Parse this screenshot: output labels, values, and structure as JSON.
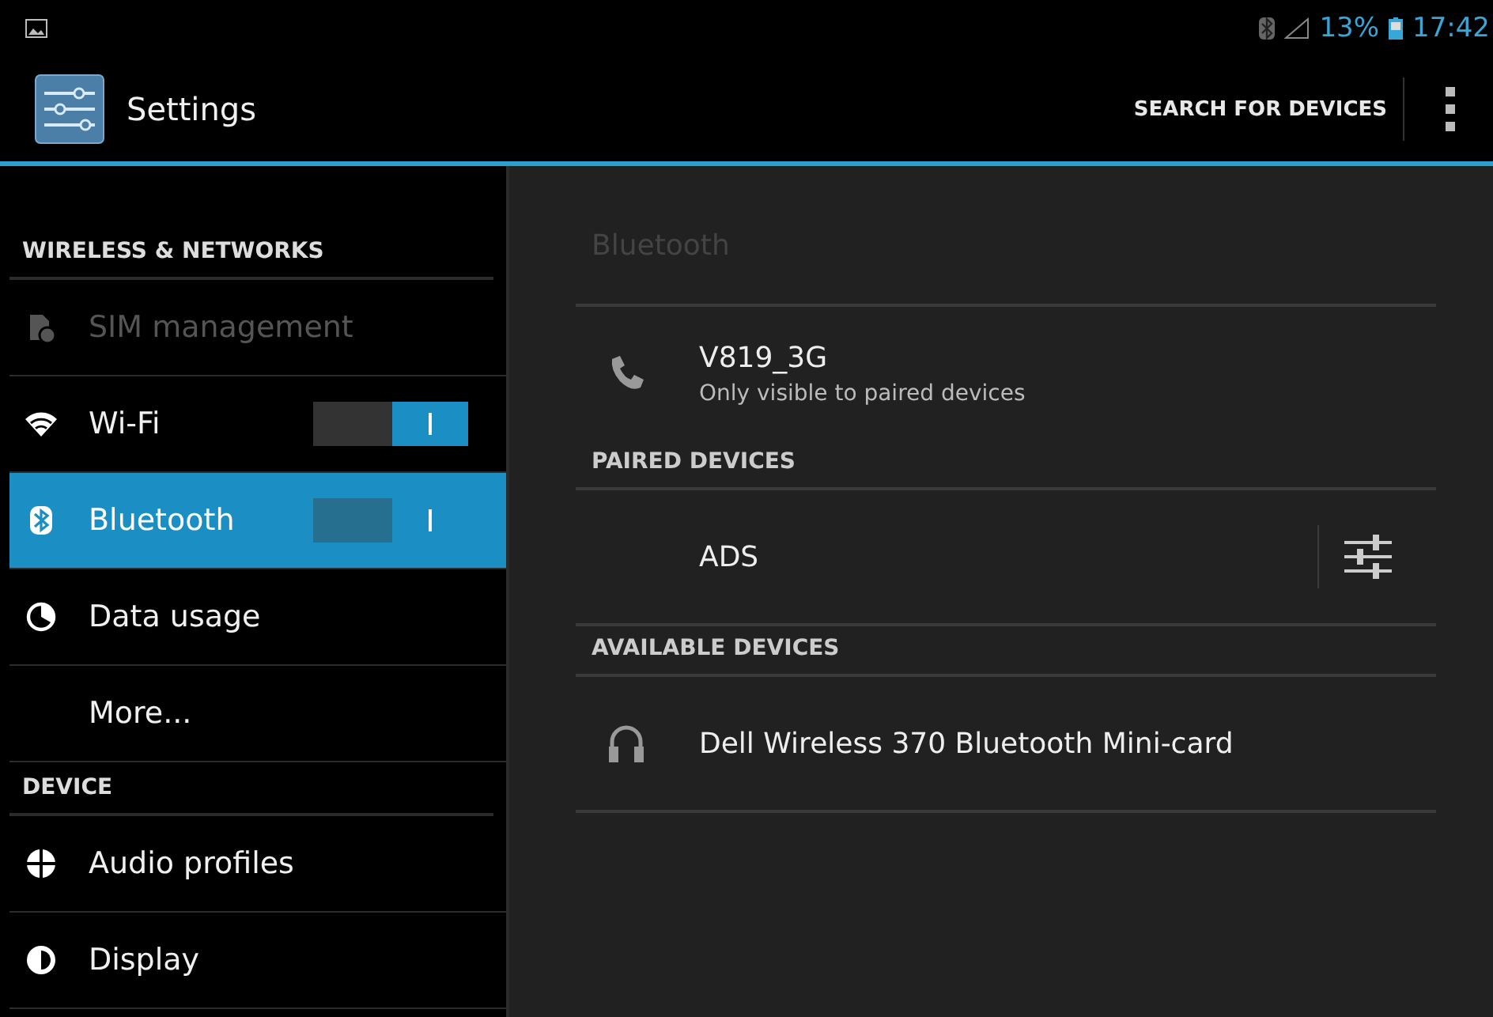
{
  "status_bar": {
    "battery": "13%",
    "time": "17:42"
  },
  "action_bar": {
    "title": "Settings",
    "action": "SEARCH FOR DEVICES"
  },
  "sidebar": {
    "sections": [
      {
        "header": "WIRELESS & NETWORKS",
        "items": [
          {
            "label": "SIM management",
            "kind": "plain",
            "disabled": true,
            "selected": false
          },
          {
            "label": "Wi-Fi",
            "kind": "toggle",
            "on": true,
            "disabled": false,
            "selected": false
          },
          {
            "label": "Bluetooth",
            "kind": "toggle",
            "on": true,
            "disabled": false,
            "selected": true
          },
          {
            "label": "Data usage",
            "kind": "plain",
            "disabled": false,
            "selected": false
          },
          {
            "label": "More...",
            "kind": "plain",
            "disabled": false,
            "selected": false
          }
        ]
      },
      {
        "header": "DEVICE",
        "items": [
          {
            "label": "Audio profiles",
            "kind": "plain",
            "disabled": false,
            "selected": false
          },
          {
            "label": "Display",
            "kind": "plain",
            "disabled": false,
            "selected": false
          }
        ]
      }
    ]
  },
  "detail": {
    "title": "Bluetooth",
    "this_device": {
      "name": "V819_3G",
      "subtitle": "Only visible to paired devices"
    },
    "groups": [
      {
        "header": "PAIRED DEVICES",
        "devices": [
          {
            "name": "ADS",
            "kind": "paired"
          }
        ]
      },
      {
        "header": "AVAILABLE DEVICES",
        "devices": [
          {
            "name": "Dell Wireless 370 Bluetooth Mini-card",
            "kind": "headset"
          }
        ]
      }
    ]
  }
}
